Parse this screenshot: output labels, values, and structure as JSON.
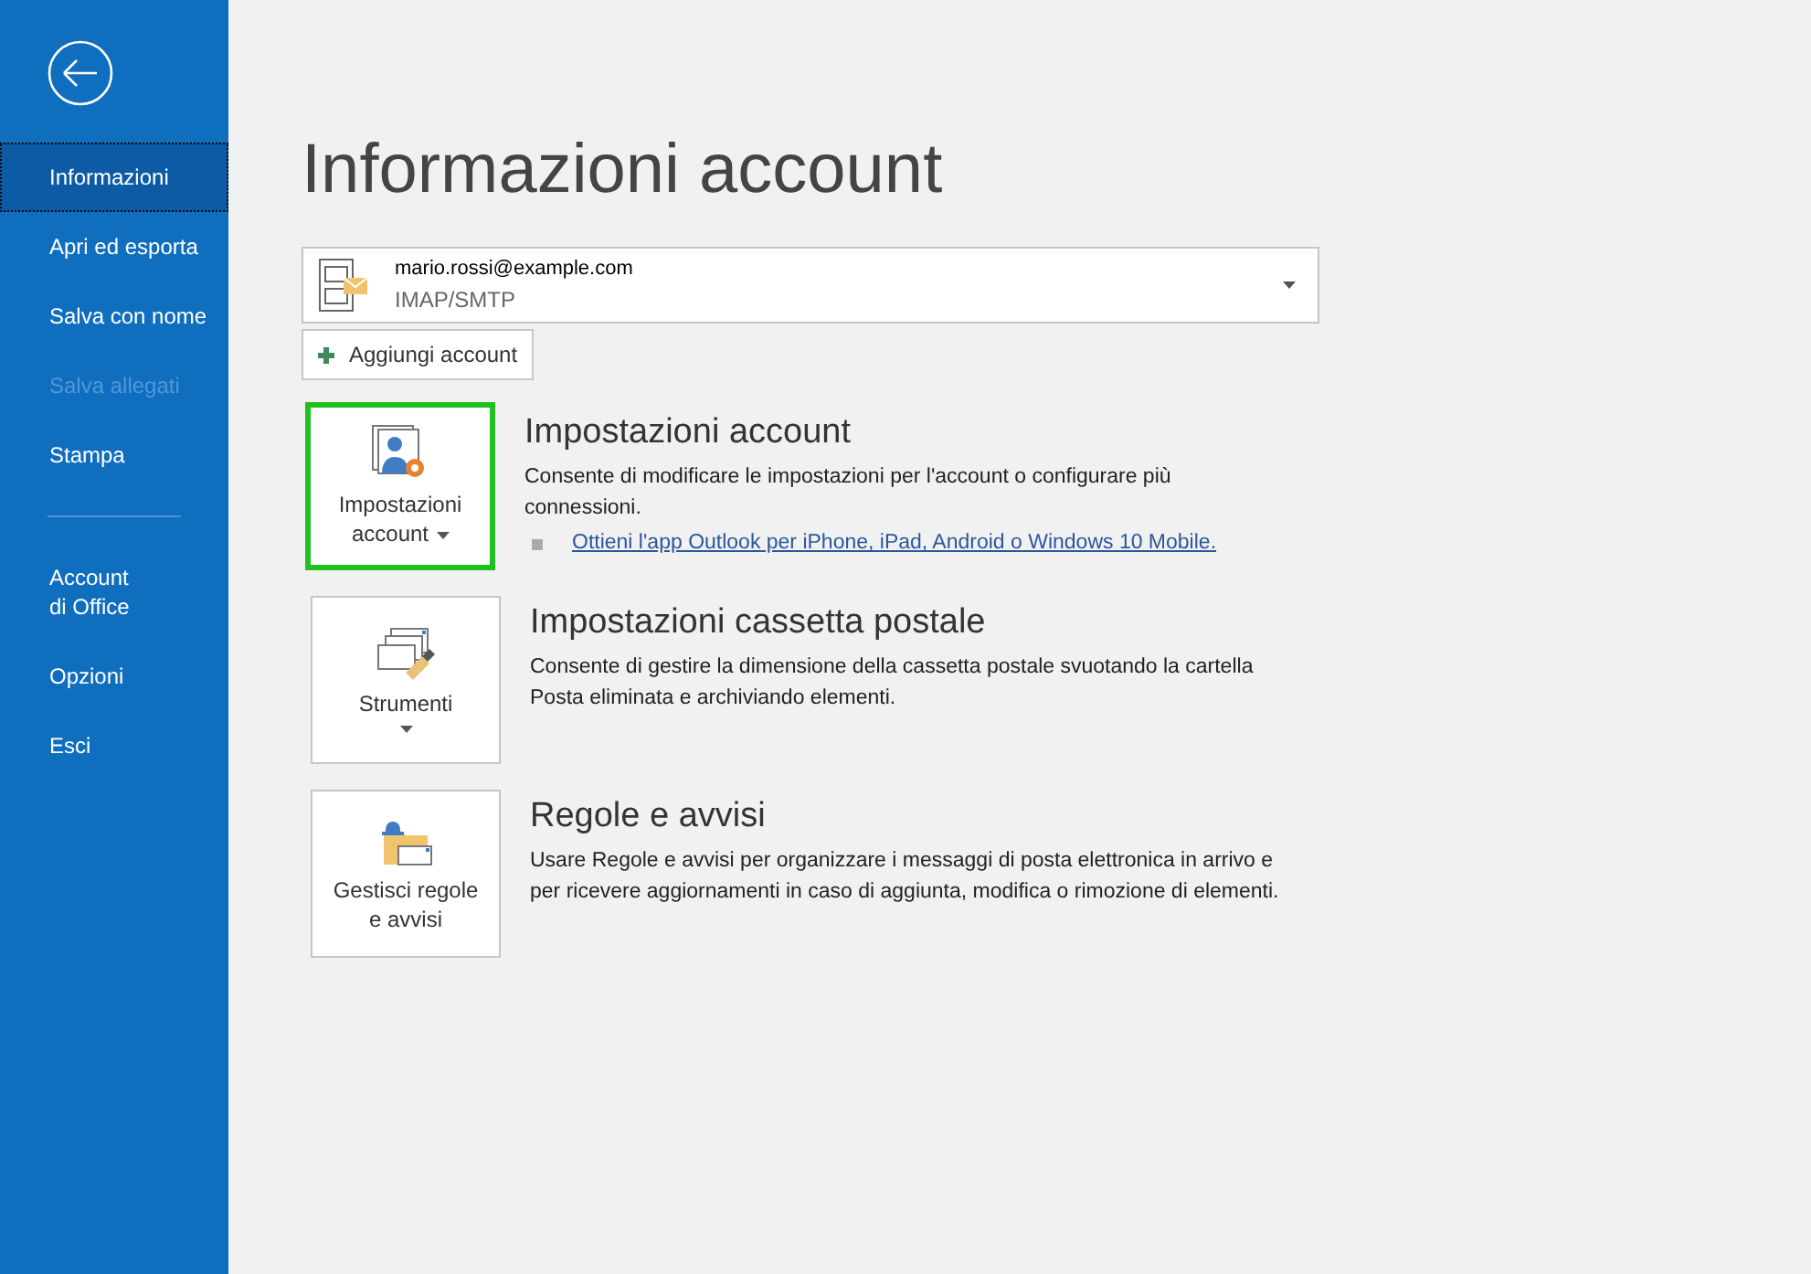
{
  "sidebar": {
    "items": [
      {
        "label": "Informazioni",
        "selected": true,
        "disabled": false
      },
      {
        "label": "Apri ed esporta",
        "selected": false,
        "disabled": false
      },
      {
        "label": "Salva con nome",
        "selected": false,
        "disabled": false
      },
      {
        "label": "Salva allegati",
        "selected": false,
        "disabled": true
      },
      {
        "label": "Stampa",
        "selected": false,
        "disabled": false
      },
      {
        "kind": "divider"
      },
      {
        "label": "Account\ndi Office",
        "selected": false,
        "disabled": false
      },
      {
        "label": "Opzioni",
        "selected": false,
        "disabled": false
      },
      {
        "label": "Esci",
        "selected": false,
        "disabled": false
      }
    ]
  },
  "title": "Informazioni account",
  "account": {
    "email": "mario.rossi@example.com",
    "type": "IMAP/SMTP"
  },
  "add_account": "Aggiungi account",
  "sections": [
    {
      "kind": "account",
      "button": "Impostazioni\naccount",
      "dropdown": true,
      "caret_below": false,
      "highlighted": true,
      "title": "Impostazioni account",
      "description": "Consente di modificare le impostazioni per l'account o configurare più connessioni.",
      "link": "Ottieni l'app Outlook per iPhone, iPad, Android o Windows 10 Mobile."
    },
    {
      "kind": "tools",
      "button": "Strumenti",
      "dropdown": true,
      "caret_below": true,
      "highlighted": false,
      "title": "Impostazioni cassetta postale",
      "description": "Consente di gestire la dimensione della cassetta postale svuotando la cartella Posta eliminata e archiviando elementi."
    },
    {
      "kind": "rules",
      "button": "Gestisci regole\ne avvisi",
      "dropdown": false,
      "highlighted": false,
      "title": "Regole e avvisi",
      "description": "Usare Regole e avvisi per organizzare i messaggi di posta elettronica in arrivo e per ricevere aggiornamenti in caso di aggiunta, modifica o rimozione di elementi."
    }
  ]
}
